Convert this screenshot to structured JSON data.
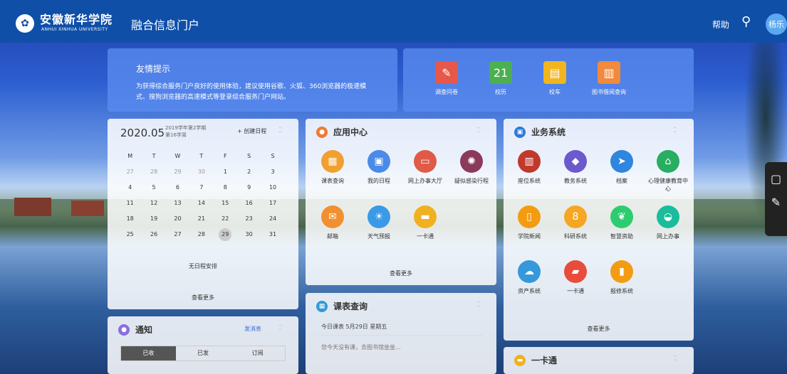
{
  "header": {
    "school_cn": "安徽新华学院",
    "school_en": "ANHUI XINHUA UNIVERSITY",
    "portal": "融合信息门户",
    "help": "帮助",
    "avatar": "杨乐"
  },
  "tip": {
    "title": "友情提示",
    "desc": "为获得综合服务门户良好的使用体验，建议使用谷歌、火狐、360浏览器的极速模式、搜狗浏览器的高速模式等登录综合服务门户网站。"
  },
  "quick": [
    {
      "label": "调查问卷",
      "icon": "pencil-icon",
      "color": "#e6584a"
    },
    {
      "label": "校历",
      "icon": "calendar-icon",
      "color": "#4caf50"
    },
    {
      "label": "校车",
      "icon": "bus-icon",
      "color": "#f2b51f"
    },
    {
      "label": "图书借阅查询",
      "icon": "book-icon",
      "color": "#f08a3c"
    }
  ],
  "calendar": {
    "year_month": "2020.05",
    "semester": "2019学年第2学期",
    "week": "第16学周",
    "new_label": "+ 创建日程",
    "weekdays": [
      "M",
      "T",
      "W",
      "T",
      "F",
      "S",
      "S"
    ],
    "weeks": [
      [
        "27",
        "28",
        "29",
        "30",
        "1",
        "2",
        "3"
      ],
      [
        "4",
        "5",
        "6",
        "7",
        "8",
        "9",
        "10"
      ],
      [
        "11",
        "12",
        "13",
        "14",
        "15",
        "16",
        "17"
      ],
      [
        "18",
        "19",
        "20",
        "21",
        "22",
        "23",
        "24"
      ],
      [
        "25",
        "26",
        "27",
        "28",
        "29",
        "30",
        "31"
      ]
    ],
    "no_event": "无日程安排",
    "more": "查看更多"
  },
  "app": {
    "title": "应用中心",
    "more": "查看更多",
    "items": [
      {
        "label": "课表查询",
        "color": "#f0a030"
      },
      {
        "label": "我的日程",
        "color": "#4a8ae8"
      },
      {
        "label": "网上办事大厅",
        "color": "#e05a48"
      },
      {
        "label": "疑似感染行程",
        "color": "#8a3a5a"
      },
      {
        "label": "邮箱",
        "color": "#f09030"
      },
      {
        "label": "天气预报",
        "color": "#3a9ae8"
      },
      {
        "label": "一卡通",
        "color": "#f0b020"
      }
    ]
  },
  "biz": {
    "title": "业务系统",
    "more": "查看更多",
    "items": [
      {
        "label": "座位系统",
        "color": "#c0392b"
      },
      {
        "label": "教务系统",
        "color": "#6a5acd"
      },
      {
        "label": "档案",
        "color": "#2e86de"
      },
      {
        "label": "心理健康教育中心",
        "color": "#27ae60"
      },
      {
        "label": "学院新闻",
        "color": "#f39c12"
      },
      {
        "label": "科研系统",
        "color": "#f5a623"
      },
      {
        "label": "智慧资助",
        "color": "#2ecc71"
      },
      {
        "label": "网上办事",
        "color": "#1abc9c"
      },
      {
        "label": "资产系统",
        "color": "#3498db"
      },
      {
        "label": "一卡通",
        "color": "#e74c3c"
      },
      {
        "label": "报修系统",
        "color": "#f39c12"
      }
    ]
  },
  "notice": {
    "title": "通知",
    "send": "发消息",
    "tabs": [
      "已收",
      "已发",
      "订阅"
    ]
  },
  "course": {
    "title": "课表查询",
    "today": "今日课表 5月29日 星期五",
    "none": "您今天没有课，去图书馆坐坐..."
  },
  "card": {
    "title": "一卡通"
  }
}
